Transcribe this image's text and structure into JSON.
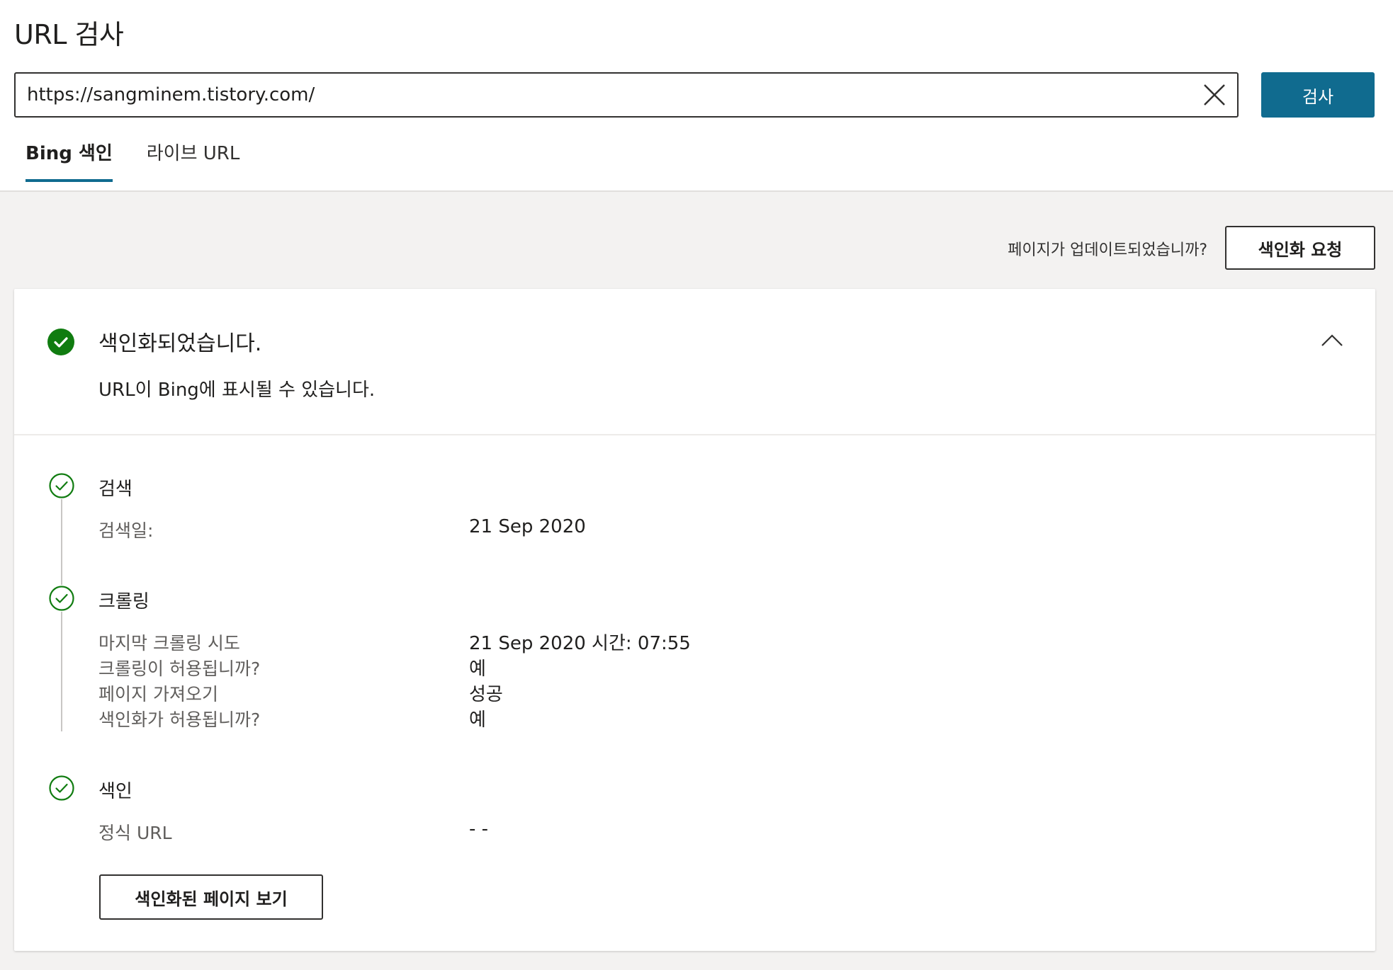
{
  "header": {
    "title": "URL 검사",
    "url_value": "https://sangminem.tistory.com/",
    "inspect_label": "검사"
  },
  "tabs": [
    {
      "label": "Bing 색인",
      "active": true
    },
    {
      "label": "라이브 URL",
      "active": false
    }
  ],
  "actions": {
    "updated_question": "페이지가 업데이트되었습니까?",
    "request_index_label": "색인화 요청"
  },
  "status": {
    "title": "색인화되었습니다.",
    "description": "URL이 Bing에 표시될 수 있습니다."
  },
  "steps": {
    "discovery": {
      "title": "검색",
      "rows": [
        {
          "label": "검색일:",
          "value": "21 Sep 2020"
        }
      ]
    },
    "crawling": {
      "title": "크롤링",
      "rows": [
        {
          "label": "마지막 크롤링 시도",
          "value": "21 Sep 2020 시간: 07:55"
        },
        {
          "label": "크롤링이 허용됩니까?",
          "value": "예"
        },
        {
          "label": "페이지 가져오기",
          "value": "성공"
        },
        {
          "label": "색인화가 허용됩니까?",
          "value": "예"
        }
      ]
    },
    "indexing": {
      "title": "색인",
      "rows": [
        {
          "label": "정식 URL",
          "value": "- -"
        }
      ]
    }
  },
  "view_indexed_label": "색인화된 페이지 보기",
  "colors": {
    "accent": "#106b8f",
    "success": "#107c10",
    "background": "#f3f2f1"
  },
  "icons": [
    "close-icon",
    "check-circle-filled-icon",
    "chevron-up-icon",
    "check-circle-outline-icon"
  ]
}
